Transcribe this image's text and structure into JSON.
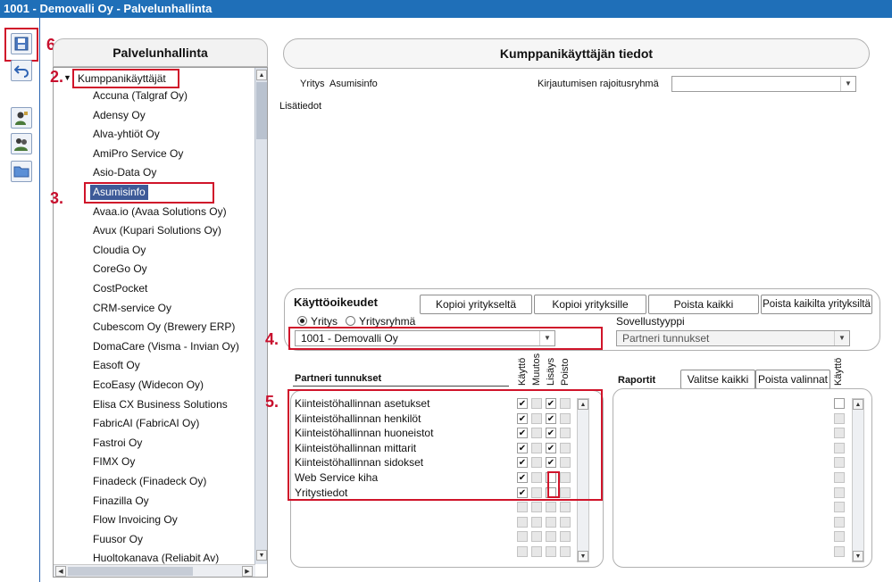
{
  "window": {
    "title": "1001 - Demovalli Oy - Palvelunhallinta"
  },
  "toolbar": {
    "icons": [
      "save-icon",
      "undo-icon",
      "user-tool-icon",
      "user-group-tool-icon",
      "folder-icon"
    ]
  },
  "annotations": {
    "a2": "2.",
    "a3": "3.",
    "a4": "4.",
    "a5": "5.",
    "a6": "6."
  },
  "tree_panel": {
    "title": "Palvelunhallinta",
    "root_label": "Kumppanikäyttäjät",
    "items": [
      "Accuna (Talgraf Oy)",
      "Adensy Oy",
      "Alva-yhtiöt Oy",
      "AmiPro Service Oy",
      "Asio-Data Oy",
      "Asumisinfo",
      "Avaa.io (Avaa Solutions Oy)",
      "Avux (Kupari Solutions Oy)",
      "Cloudia Oy",
      "CoreGo Oy",
      "CostPocket",
      "CRM-service Oy",
      "Cubescom Oy (Brewery ERP)",
      "DomaCare (Visma - Invian Oy)",
      "Easoft Oy",
      "EcoEasy (Widecon Oy)",
      "Elisa CX Business Solutions",
      "FabricAI (FabricAI Oy)",
      "Fastroi Oy",
      "FIMX Oy",
      "Finadeck (Finadeck Oy)",
      "Finazilla Oy",
      "Flow Invoicing Oy",
      "Fuusor Oy",
      "Huoltokanava (Reliabit Av)"
    ],
    "selected_index": 5
  },
  "details": {
    "title": "Kumppanikäyttäjän tiedot",
    "company_label": "Yritys",
    "company_value": "Asumisinfo",
    "login_group_label": "Kirjautumisen rajoitusryhmä",
    "login_group_value": "",
    "extra_label": "Lisätiedot"
  },
  "permissions": {
    "title": "Käyttöoikeudet",
    "buttons": [
      "Kopioi yritykseltä",
      "Kopioi yrityksille",
      "Poista kaikki",
      "Poista kaikilta yrityksiltä"
    ],
    "radio_company": "Yritys",
    "radio_group": "Yritysryhmä",
    "radio_selected": "Yritys",
    "company_select_value": "1001 - Demovalli Oy",
    "app_type_label": "Sovellustyyppi",
    "app_type_value": "Partneri tunnukset",
    "partner_header": "Partneri tunnukset",
    "col_headers": [
      "Käyttö",
      "Muutos",
      "Lisäys",
      "Poisto"
    ],
    "rows": [
      {
        "label": "Kiinteistöhallinnan asetukset",
        "checks": [
          true,
          false,
          true,
          false
        ]
      },
      {
        "label": "Kiinteistöhallinnan henkilöt",
        "checks": [
          true,
          false,
          true,
          false
        ]
      },
      {
        "label": "Kiinteistöhallinnan huoneistot",
        "checks": [
          true,
          false,
          true,
          false
        ]
      },
      {
        "label": "Kiinteistöhallinnan mittarit",
        "checks": [
          true,
          false,
          true,
          false
        ]
      },
      {
        "label": "Kiinteistöhallinnan sidokset",
        "checks": [
          true,
          false,
          true,
          false
        ]
      },
      {
        "label": "Web Service kiha",
        "checks": [
          true,
          false,
          false,
          false
        ]
      },
      {
        "label": "Yritystiedot",
        "checks": [
          true,
          false,
          false,
          false
        ]
      }
    ],
    "reports_header": "Raportit",
    "reports_select_all": "Valitse kaikki",
    "reports_clear": "Poista valinnat",
    "reports_col": "Käyttö"
  }
}
